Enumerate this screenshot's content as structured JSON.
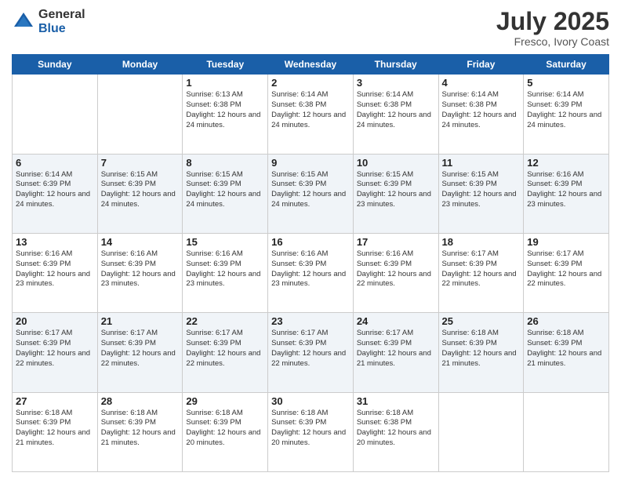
{
  "logo": {
    "general": "General",
    "blue": "Blue"
  },
  "title": "July 2025",
  "location": "Fresco, Ivory Coast",
  "weekdays": [
    "Sunday",
    "Monday",
    "Tuesday",
    "Wednesday",
    "Thursday",
    "Friday",
    "Saturday"
  ],
  "weeks": [
    [
      {
        "day": "",
        "info": ""
      },
      {
        "day": "",
        "info": ""
      },
      {
        "day": "1",
        "info": "Sunrise: 6:13 AM\nSunset: 6:38 PM\nDaylight: 12 hours and 24 minutes."
      },
      {
        "day": "2",
        "info": "Sunrise: 6:14 AM\nSunset: 6:38 PM\nDaylight: 12 hours and 24 minutes."
      },
      {
        "day": "3",
        "info": "Sunrise: 6:14 AM\nSunset: 6:38 PM\nDaylight: 12 hours and 24 minutes."
      },
      {
        "day": "4",
        "info": "Sunrise: 6:14 AM\nSunset: 6:38 PM\nDaylight: 12 hours and 24 minutes."
      },
      {
        "day": "5",
        "info": "Sunrise: 6:14 AM\nSunset: 6:39 PM\nDaylight: 12 hours and 24 minutes."
      }
    ],
    [
      {
        "day": "6",
        "info": "Sunrise: 6:14 AM\nSunset: 6:39 PM\nDaylight: 12 hours and 24 minutes."
      },
      {
        "day": "7",
        "info": "Sunrise: 6:15 AM\nSunset: 6:39 PM\nDaylight: 12 hours and 24 minutes."
      },
      {
        "day": "8",
        "info": "Sunrise: 6:15 AM\nSunset: 6:39 PM\nDaylight: 12 hours and 24 minutes."
      },
      {
        "day": "9",
        "info": "Sunrise: 6:15 AM\nSunset: 6:39 PM\nDaylight: 12 hours and 24 minutes."
      },
      {
        "day": "10",
        "info": "Sunrise: 6:15 AM\nSunset: 6:39 PM\nDaylight: 12 hours and 23 minutes."
      },
      {
        "day": "11",
        "info": "Sunrise: 6:15 AM\nSunset: 6:39 PM\nDaylight: 12 hours and 23 minutes."
      },
      {
        "day": "12",
        "info": "Sunrise: 6:16 AM\nSunset: 6:39 PM\nDaylight: 12 hours and 23 minutes."
      }
    ],
    [
      {
        "day": "13",
        "info": "Sunrise: 6:16 AM\nSunset: 6:39 PM\nDaylight: 12 hours and 23 minutes."
      },
      {
        "day": "14",
        "info": "Sunrise: 6:16 AM\nSunset: 6:39 PM\nDaylight: 12 hours and 23 minutes."
      },
      {
        "day": "15",
        "info": "Sunrise: 6:16 AM\nSunset: 6:39 PM\nDaylight: 12 hours and 23 minutes."
      },
      {
        "day": "16",
        "info": "Sunrise: 6:16 AM\nSunset: 6:39 PM\nDaylight: 12 hours and 23 minutes."
      },
      {
        "day": "17",
        "info": "Sunrise: 6:16 AM\nSunset: 6:39 PM\nDaylight: 12 hours and 22 minutes."
      },
      {
        "day": "18",
        "info": "Sunrise: 6:17 AM\nSunset: 6:39 PM\nDaylight: 12 hours and 22 minutes."
      },
      {
        "day": "19",
        "info": "Sunrise: 6:17 AM\nSunset: 6:39 PM\nDaylight: 12 hours and 22 minutes."
      }
    ],
    [
      {
        "day": "20",
        "info": "Sunrise: 6:17 AM\nSunset: 6:39 PM\nDaylight: 12 hours and 22 minutes."
      },
      {
        "day": "21",
        "info": "Sunrise: 6:17 AM\nSunset: 6:39 PM\nDaylight: 12 hours and 22 minutes."
      },
      {
        "day": "22",
        "info": "Sunrise: 6:17 AM\nSunset: 6:39 PM\nDaylight: 12 hours and 22 minutes."
      },
      {
        "day": "23",
        "info": "Sunrise: 6:17 AM\nSunset: 6:39 PM\nDaylight: 12 hours and 22 minutes."
      },
      {
        "day": "24",
        "info": "Sunrise: 6:17 AM\nSunset: 6:39 PM\nDaylight: 12 hours and 21 minutes."
      },
      {
        "day": "25",
        "info": "Sunrise: 6:18 AM\nSunset: 6:39 PM\nDaylight: 12 hours and 21 minutes."
      },
      {
        "day": "26",
        "info": "Sunrise: 6:18 AM\nSunset: 6:39 PM\nDaylight: 12 hours and 21 minutes."
      }
    ],
    [
      {
        "day": "27",
        "info": "Sunrise: 6:18 AM\nSunset: 6:39 PM\nDaylight: 12 hours and 21 minutes."
      },
      {
        "day": "28",
        "info": "Sunrise: 6:18 AM\nSunset: 6:39 PM\nDaylight: 12 hours and 21 minutes."
      },
      {
        "day": "29",
        "info": "Sunrise: 6:18 AM\nSunset: 6:39 PM\nDaylight: 12 hours and 20 minutes."
      },
      {
        "day": "30",
        "info": "Sunrise: 6:18 AM\nSunset: 6:39 PM\nDaylight: 12 hours and 20 minutes."
      },
      {
        "day": "31",
        "info": "Sunrise: 6:18 AM\nSunset: 6:38 PM\nDaylight: 12 hours and 20 minutes."
      },
      {
        "day": "",
        "info": ""
      },
      {
        "day": "",
        "info": ""
      }
    ]
  ]
}
